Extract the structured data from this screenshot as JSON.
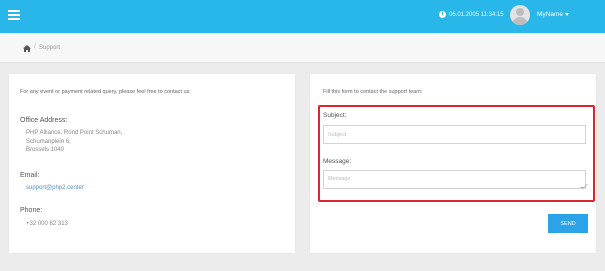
{
  "header": {
    "datetime": "06.01.2005 11:34:15",
    "user_name": "MyName",
    "icons": {
      "menu": "hamburger-icon",
      "clock": "clock-icon",
      "avatar": "avatar-icon",
      "dropdown": "chevron-down-icon"
    }
  },
  "breadcrumb": {
    "separator": "/",
    "current": "Support",
    "icon": "home-icon"
  },
  "contact_info": {
    "intro": "For any event or payment related query, please feel free to contact us:",
    "office_label": "Office Address:",
    "office_lines": [
      "PHP Alliance, Rond Point Schuman,",
      "Schumanplein 6,",
      "Brussels 1040"
    ],
    "email_label": "Email:",
    "email": "support@php2.center",
    "phone_label": "Phone:",
    "phone": "+32 000 82 313"
  },
  "form": {
    "intro": "Fill this form to contact the support team:",
    "subject_label": "Subject:",
    "subject_placeholder": "Subject",
    "subject_value": "",
    "message_label": "Message:",
    "message_placeholder": "Message",
    "message_value": "",
    "send_label": "SEND"
  },
  "colors": {
    "topbar": "#29b6e8",
    "highlight": "#d9272e",
    "send_button": "#2ba3e6",
    "link": "#5b8fc7"
  }
}
